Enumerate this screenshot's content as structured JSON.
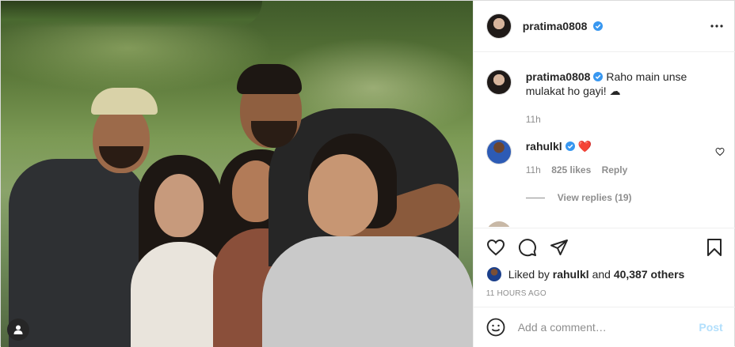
{
  "post": {
    "author": "pratima0808",
    "header": {
      "username": "pratima0808",
      "more_icon": "more-horizontal-icon"
    },
    "caption": {
      "username": "pratima0808",
      "text": "Raho main unse mulakat ho gayi! ☁",
      "time": "11h"
    },
    "comments": [
      {
        "username": "rahulkl",
        "text": "❤️",
        "time": "11h",
        "likes": "825 likes",
        "reply_label": "Reply",
        "view_replies": "View replies (19)"
      }
    ],
    "likes": {
      "prefix": "Liked by",
      "first_user": "rahulkl",
      "joiner": "and",
      "others": "40,387 others"
    },
    "timestamp": "11 HOURS AGO",
    "comment_box": {
      "placeholder": "Add a comment…",
      "post_label": "Post"
    }
  },
  "colors": {
    "verified": "#3897f0",
    "link_blue_disabled": "#b2dffc",
    "muted_text": "#8e8e8e",
    "heart_red": "#ed4956"
  }
}
